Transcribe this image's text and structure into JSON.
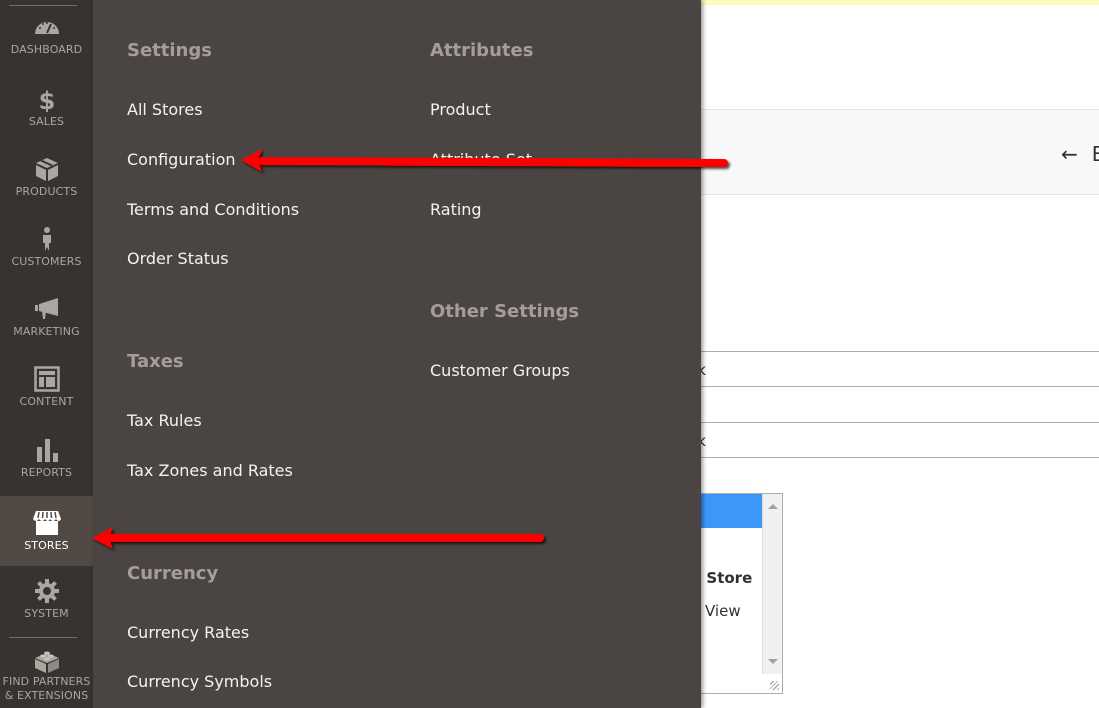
{
  "sidebar": {
    "items": [
      {
        "label": "DASHBOARD",
        "icon": "dashboard-icon"
      },
      {
        "label": "SALES",
        "icon": "dollar-icon"
      },
      {
        "label": "PRODUCTS",
        "icon": "box-icon"
      },
      {
        "label": "CUSTOMERS",
        "icon": "person-icon"
      },
      {
        "label": "MARKETING",
        "icon": "megaphone-icon"
      },
      {
        "label": "CONTENT",
        "icon": "layout-icon"
      },
      {
        "label": "REPORTS",
        "icon": "bar-chart-icon"
      },
      {
        "label": "STORES",
        "icon": "storefront-icon",
        "active": true
      },
      {
        "label": "SYSTEM",
        "icon": "gear-icon"
      },
      {
        "label_line1": "FIND PARTNERS",
        "label_line2": "& EXTENSIONS",
        "icon": "lego-brick-icon"
      }
    ]
  },
  "flyout": {
    "left_column": [
      {
        "title": "Settings",
        "links": [
          "All Stores",
          "Configuration",
          "Terms and Conditions",
          "Order Status"
        ]
      },
      {
        "title": "Taxes",
        "links": [
          "Tax Rules",
          "Tax Zones and Rates"
        ]
      },
      {
        "title": "Currency",
        "links": [
          "Currency Rates",
          "Currency Symbols"
        ]
      }
    ],
    "right_column": [
      {
        "title": "Attributes",
        "links": [
          "Product",
          "Attribute Set",
          "Rating"
        ]
      },
      {
        "title": "Other Settings",
        "links": [
          "Customer Groups"
        ]
      }
    ]
  },
  "background": {
    "back_button": {
      "arrow": "←",
      "label": "B"
    },
    "fields": [
      "ck",
      "",
      "ck"
    ],
    "listbox_options": [
      {
        "text": "",
        "selected": true
      },
      {
        "text": "e Store",
        "bold": true
      },
      {
        "text": "e View",
        "bold": false
      }
    ]
  },
  "annotations": {
    "color": "#ff0000",
    "arrows": [
      "points-to-configuration",
      "points-to-stores"
    ]
  }
}
